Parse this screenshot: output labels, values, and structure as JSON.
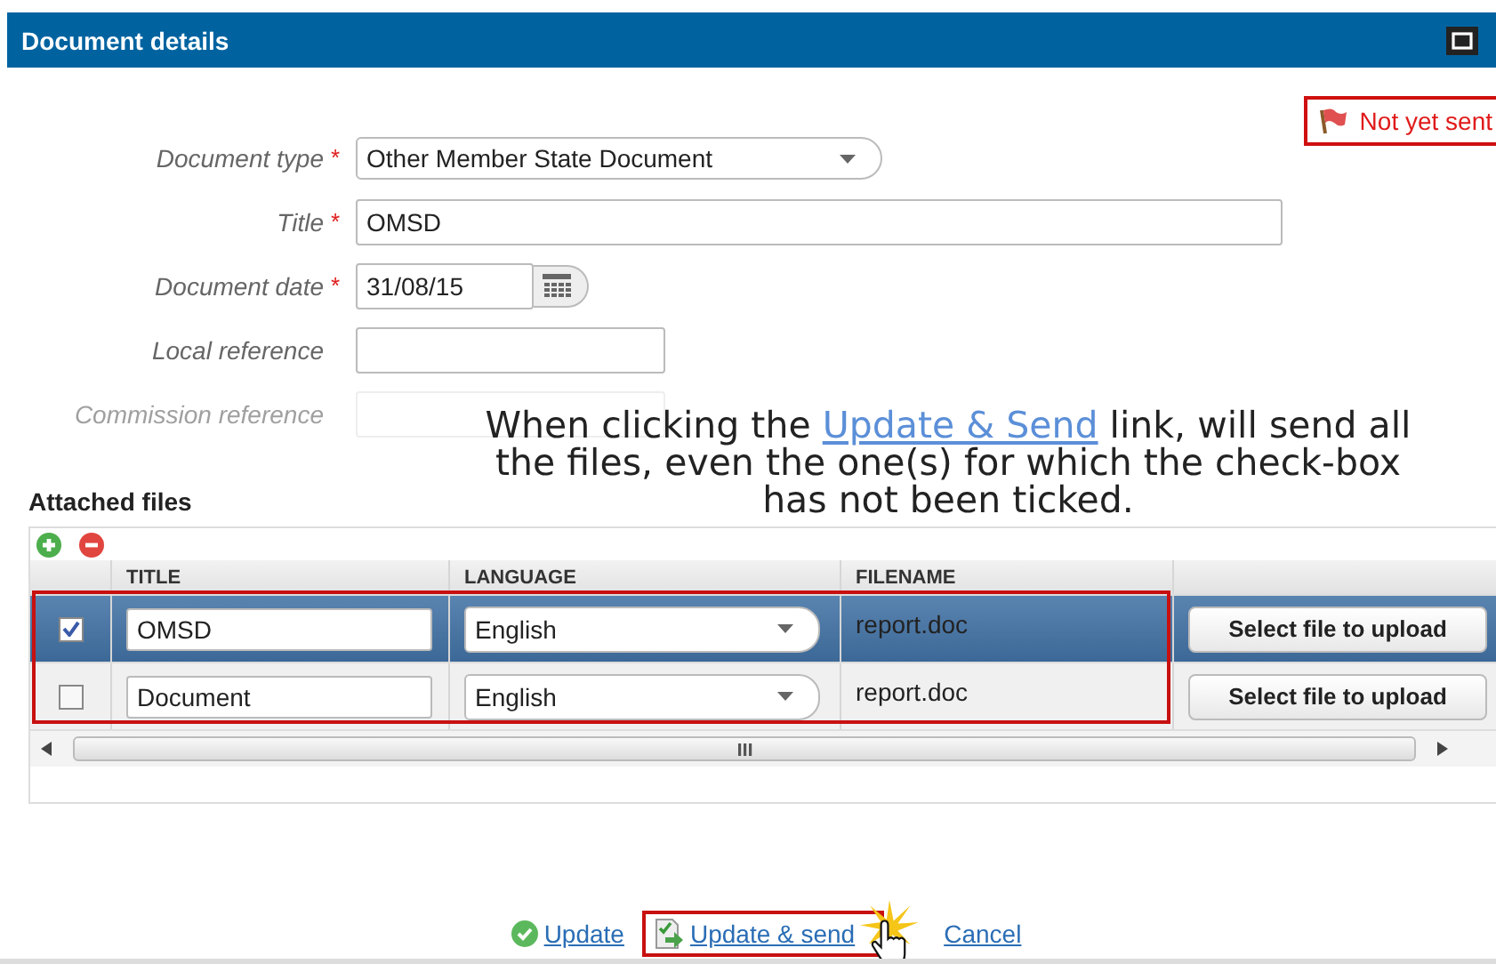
{
  "window": {
    "title": "Document details"
  },
  "status": {
    "text": "Not yet sent"
  },
  "form": {
    "fields": [
      {
        "label": "Document type",
        "required_mark": "*",
        "kind": "select",
        "value": "Other Member State Document",
        "disabled": false
      },
      {
        "label": "Title",
        "required_mark": "*",
        "kind": "text",
        "value": "OMSD",
        "disabled": false
      },
      {
        "label": "Document date",
        "required_mark": "*",
        "kind": "date",
        "value": "31/08/15",
        "disabled": false
      },
      {
        "label": "Local reference",
        "kind": "text",
        "disabled": false
      },
      {
        "label": "Commission reference",
        "kind": "text",
        "disabled": true
      }
    ]
  },
  "annotation": {
    "before": "When clicking the ",
    "link": "Update & Send",
    "after": " link, will send all the files, even the one(s) for which the check-box has not been ticked."
  },
  "attached_files": {
    "title": "Attached files",
    "columns": [
      "TITLE",
      "LANGUAGE",
      "FILENAME"
    ],
    "rows": [
      {
        "checked": true,
        "selected": true,
        "title": "OMSD",
        "language": "English",
        "filename": "report.doc",
        "button": "Select file to upload"
      },
      {
        "checked": false,
        "selected": false,
        "title": "Document",
        "language": "English",
        "filename": "report.doc",
        "button": "Select file to upload"
      }
    ]
  },
  "actions": [
    {
      "kind": "update",
      "label": "Update",
      "highlighted": false
    },
    {
      "kind": "update_send",
      "label": "Update & send",
      "highlighted": true
    },
    {
      "kind": "cancel",
      "label": "Cancel",
      "highlighted": false
    }
  ]
}
